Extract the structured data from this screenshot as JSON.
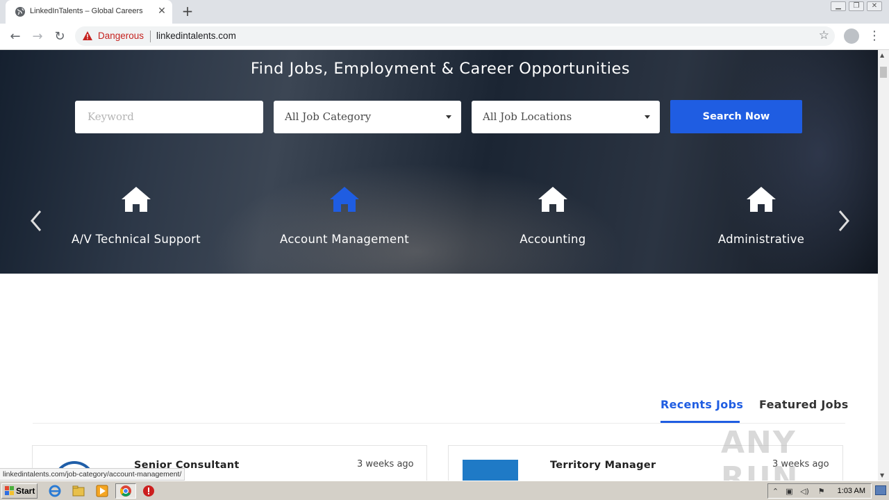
{
  "browser": {
    "tab_title": "LinkedInTalents – Global Careers",
    "tab_close": "✕",
    "new_tab": "+",
    "security_label": "Dangerous",
    "url": "linkedintalents.com",
    "status_url": "linkedintalents.com/job-category/account-management/"
  },
  "hero": {
    "title": "Find Jobs, Employment & Career Opportunities",
    "search": {
      "keyword_placeholder": "Keyword",
      "category_value": "All Job Category",
      "location_value": "All Job Locations",
      "button_label": "Search Now"
    },
    "categories": [
      {
        "label": "A/V Technical Support",
        "icon": "home-icon",
        "active": false
      },
      {
        "label": "Account Management",
        "icon": "home-icon",
        "active": true
      },
      {
        "label": "Accounting",
        "icon": "home-icon",
        "active": false
      },
      {
        "label": "Administrative",
        "icon": "home-icon",
        "active": false
      }
    ]
  },
  "jobs": {
    "tabs": [
      {
        "label": "Recents Jobs",
        "active": true
      },
      {
        "label": "Featured Jobs",
        "active": false
      }
    ],
    "listings": [
      {
        "title": "Senior Consultant",
        "posted": "3 weeks ago"
      },
      {
        "title": "Territory Manager",
        "posted": "3 weeks ago"
      }
    ]
  },
  "watermark": "ANY RUN",
  "taskbar": {
    "start_label": "Start",
    "clock": "1:03 AM"
  },
  "colors": {
    "accent": "#1f5de2",
    "danger": "#c5221f",
    "hero_dark": "#1b2533"
  }
}
